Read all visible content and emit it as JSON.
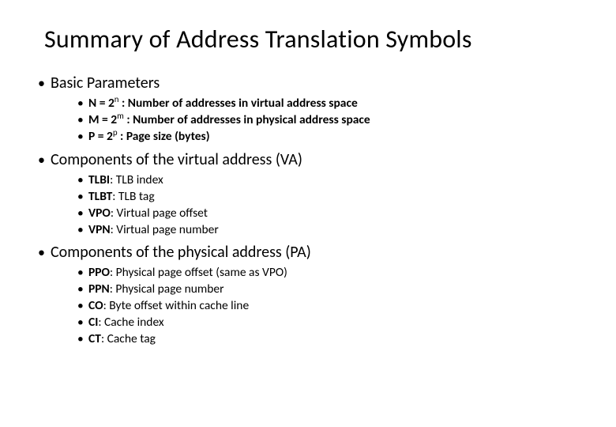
{
  "title": "Summary of Address Translation Symbols",
  "sections": [
    {
      "heading": "Basic Parameters",
      "allbold": true,
      "items": [
        {
          "head": "N = 2",
          "sup": "n",
          "rest": " : Number of addresses in virtual address space"
        },
        {
          "head": "M = 2",
          "sup": "m",
          "rest": " : Number of addresses in physical address space"
        },
        {
          "head": "P = 2",
          "sup": "p",
          "rest": "  : Page size (bytes)"
        }
      ]
    },
    {
      "heading": "Components of the virtual address (VA)",
      "allbold": false,
      "items": [
        {
          "head": "TLBI",
          "sup": "",
          "rest": ": TLB index"
        },
        {
          "head": "TLBT",
          "sup": "",
          "rest": ": TLB tag"
        },
        {
          "head": "VPO",
          "sup": "",
          "rest": ": Virtual page offset"
        },
        {
          "head": "VPN",
          "sup": "",
          "rest": ": Virtual page number"
        }
      ]
    },
    {
      "heading": "Components of the physical address (PA)",
      "allbold": false,
      "items": [
        {
          "head": "PPO",
          "sup": "",
          "rest": ": Physical page offset (same as VPO)"
        },
        {
          "head": "PPN",
          "sup": "",
          "rest": ": Physical page number"
        },
        {
          "head": "CO",
          "sup": "",
          "rest": ": Byte offset within cache line"
        },
        {
          "head": "CI",
          "sup": "",
          "rest": ": Cache index"
        },
        {
          "head": "CT",
          "sup": "",
          "rest": ": Cache tag"
        }
      ]
    }
  ]
}
